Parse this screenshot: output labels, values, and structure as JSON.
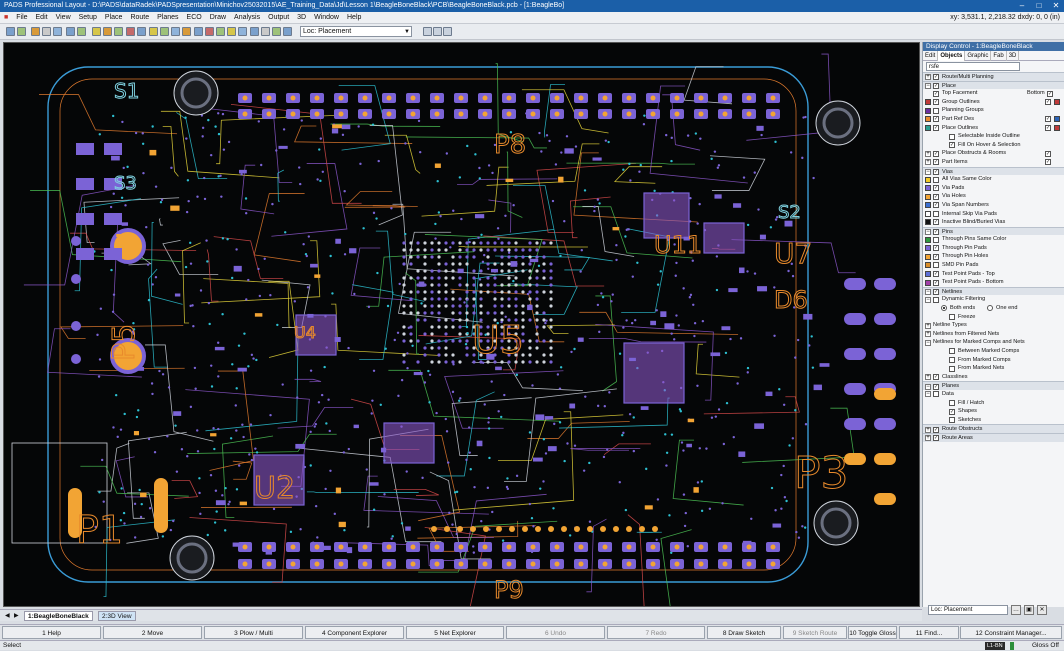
{
  "window": {
    "title": "PADS Professional Layout - D:\\PADS\\dataRadek\\PADSpresentation\\Minichov25032015\\AE_Training_Data\\Jd\\Lesson 1\\BeagleBoneBlack\\PCB\\BeagleBoneBlack.pcb - [1:BeagleBo]"
  },
  "menu": [
    "File",
    "Edit",
    "View",
    "Setup",
    "Place",
    "Route",
    "Planes",
    "ECO",
    "Draw",
    "Analysis",
    "Output",
    "3D",
    "Window",
    "Help"
  ],
  "coords": "xy: 3,531.1, 2,218.32 dxdy: 0, 0 (in)",
  "toolbar": {
    "scheme_combo": "Loc: Placement"
  },
  "board": {
    "labels": [
      "S1",
      "S3",
      "S2",
      "U11",
      "U7",
      "U4",
      "U5",
      "P5",
      "U2",
      "P1",
      "P3",
      "P8",
      "P9",
      "D6"
    ],
    "colors": {
      "background": "#050607",
      "outline": "#3a9bd6",
      "pad_violet": "#7b63d6",
      "pad_orange": "#f2a434",
      "trace_purple": "#8a56c8",
      "trace_cyan": "#2dbfd0",
      "trace_green": "#4bbf54",
      "trace_yellow": "#e4d43a",
      "trace_orange": "#e07a2e",
      "trace_red": "#d64a4a",
      "trace_white": "#cfd4dc",
      "silk_orange": "#e88a2c",
      "silk_cyan": "#7fd1e0"
    }
  },
  "panel": {
    "title": "Display Control - 1:BeagleBoneBlack",
    "tabs": [
      "Edit",
      "Objects",
      "Graphic",
      "Fab",
      "3D"
    ],
    "search_value": "rsfe",
    "sections": [
      {
        "label": "Route/Multi Planning",
        "items": []
      },
      {
        "label": "Place",
        "items": [
          {
            "label": "Top Facement",
            "right_label": "Bottom",
            "checked": true,
            "rcheck": true
          },
          {
            "label": "Group Outlines",
            "swatch": "#c03a3a",
            "checked": true,
            "rcheck": true,
            "rswatch": "#c03a3a"
          },
          {
            "label": "Planning Groups",
            "swatch": "#6a2fa0",
            "checked": false
          },
          {
            "label": "Part Ref Des",
            "swatch": "#e88a2c",
            "checked": true,
            "rcheck": true,
            "rswatch": "#2a63b8"
          },
          {
            "label": "Place Outlines",
            "swatch": "#2a9d8f",
            "checked": true,
            "rcheck": true,
            "rswatch": "#c03a3a"
          },
          {
            "label": "Selectable Inside Outline",
            "indent": true,
            "checked": false
          },
          {
            "label": "Fill On Hover & Selection",
            "indent": true,
            "checked": true
          },
          {
            "label": "Place Obstructs & Rooms",
            "toggle": "+",
            "checked": true,
            "rcheck": true
          },
          {
            "label": "Part Items",
            "toggle": "+",
            "checked": true,
            "rcheck": true
          }
        ]
      },
      {
        "label": "Vias",
        "items": [
          {
            "label": "All Vias Same Color",
            "swatch": "#f2c924",
            "checked": false
          },
          {
            "label": "Via Pads",
            "swatch": "#7b63d6",
            "checked": true
          },
          {
            "label": "Via Holes",
            "swatch": "#f2a434",
            "checked": true
          },
          {
            "label": "Via Span Numbers",
            "swatch": "#3b6fd1",
            "checked": true
          },
          {
            "label": "Internal Skip Via Pads",
            "swatch": "#ffffff",
            "checked": false
          },
          {
            "label": "Inactive Blind/Buried Vias",
            "swatch": "#111111",
            "checked": true
          }
        ]
      },
      {
        "label": "Pins",
        "items": [
          {
            "label": "Through Pins Same Color",
            "swatch": "#2e9a3e",
            "checked": false
          },
          {
            "label": "Through Pin Pads",
            "swatch": "#7b63d6",
            "checked": true
          },
          {
            "label": "Through Pin Holes",
            "swatch": "#f2a434",
            "checked": true
          },
          {
            "label": "SMD Pin Pads",
            "swatch": "#d98d2a",
            "checked": false
          },
          {
            "label": "Test Point Pads - Top",
            "swatch": "#5d6fd8",
            "checked": true
          },
          {
            "label": "Test Point Pads - Bottom",
            "swatch": "#a23fa8",
            "checked": true
          }
        ]
      },
      {
        "label": "Netlines",
        "items": [
          {
            "label": "Dynamic Filtering",
            "toggle": "-",
            "checked": false
          },
          {
            "label": "Both ends",
            "radio": true,
            "selected": true,
            "right_label": "One end"
          },
          {
            "label": "Freeze",
            "indent": true,
            "checked": false
          },
          {
            "label": "Netline Types",
            "toggle": "+"
          },
          {
            "label": "Netlines from Filtered Nets",
            "toggle": "+"
          },
          {
            "label": "Netlines for Marked Comps and Nets",
            "toggle": "-"
          },
          {
            "label": "Between Marked Comps",
            "indent": true,
            "checked": false
          },
          {
            "label": "From Marked Comps",
            "indent": true,
            "checked": false
          },
          {
            "label": "From Marked Nets",
            "indent": true,
            "checked": false
          },
          {
            "label": "Classlines",
            "toggle": "+",
            "checked": true
          }
        ]
      },
      {
        "label": "Planes",
        "items": [
          {
            "label": "Data",
            "toggle": "-",
            "checked": false
          },
          {
            "label": "Fill / Hatch",
            "indent": true,
            "checked": false
          },
          {
            "label": "Shapes",
            "indent": true,
            "checked": true
          },
          {
            "label": "Sketches",
            "indent": true,
            "checked": false
          }
        ]
      },
      {
        "label": "Route Obstructs",
        "items": []
      },
      {
        "label": "Route Areas",
        "items": []
      }
    ],
    "bottom_combo": "Loc: Placement"
  },
  "view_tabs": [
    "1:BeagleBoneBlack",
    "2:3D View"
  ],
  "function_keys": [
    {
      "label": "1 Help",
      "enabled": true
    },
    {
      "label": "2 Move",
      "enabled": true
    },
    {
      "label": "3 Plow / Multi",
      "enabled": true
    },
    {
      "label": "4 Component Explorer",
      "enabled": true
    },
    {
      "label": "5 Net Explorer",
      "enabled": true
    },
    {
      "label": "6 Undo",
      "enabled": false
    },
    {
      "label": "7 Redo",
      "enabled": false
    },
    {
      "label": "8 Draw Sketch",
      "enabled": true
    },
    {
      "label": "9 Sketch Route",
      "enabled": false
    },
    {
      "label": "10 Toggle Gloss",
      "enabled": true
    },
    {
      "label": "11 Find...",
      "enabled": true
    },
    {
      "label": "12 Constraint Manager...",
      "enabled": true
    }
  ],
  "status": {
    "left": "Select",
    "layer": "L1-BN",
    "gloss": "Gloss Off"
  }
}
